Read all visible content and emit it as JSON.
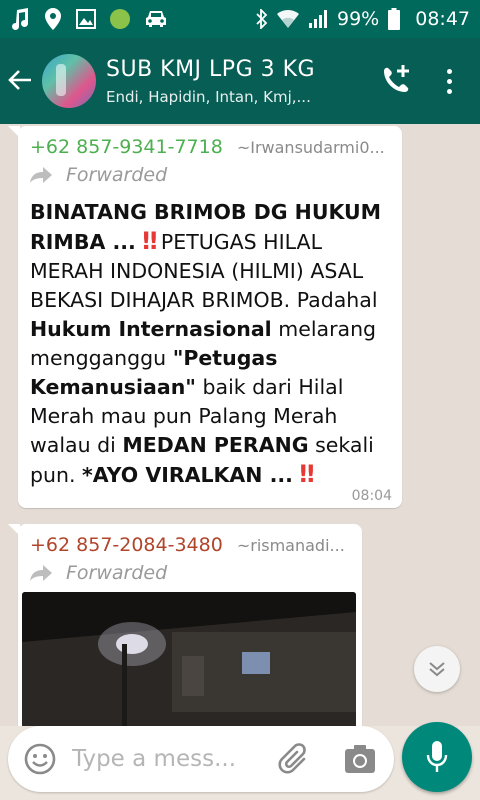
{
  "status_bar": {
    "battery": "99%",
    "time": "08:47"
  },
  "header": {
    "title": "SUB KMJ LPG 3 KG",
    "subtitle": "Endi, Hapidin, Intan, Kmj,..."
  },
  "messages": [
    {
      "sender_phone": "+62 857-9341-7718",
      "sender_alias": "~Irwansudarmi0...",
      "sender_color": "#4caf50",
      "forwarded_label": "Forwarded",
      "text": {
        "p1": "BINATANG BRIMOB DG HUKUM RIMBA ...",
        "p2": "‼",
        "p3": " PETUGAS HILAL MERAH INDONESIA (HILMI) ASAL BEKASI DIHAJAR BRIMOB. Padahal ",
        "p4": "Hukum Internasional",
        "p5": " melarang mengganggu ",
        "p6": "\"Petugas Kemanusiaan\"",
        "p7": " baik dari Hilal Merah mau pun Palang Merah walau di ",
        "p8": "MEDAN PERANG",
        "p9": " sekali pun. ",
        "p10": "*AYO VIRALKAN ...",
        "p11": "‼"
      },
      "time": "08:04"
    },
    {
      "sender_phone": "+62 857-2084-3480",
      "sender_alias": "~rismanadi...",
      "sender_color": "#b0452b",
      "forwarded_label": "Forwarded"
    }
  ],
  "input": {
    "placeholder": "Type a mess..."
  },
  "colors": {
    "status_bar": "#00695c",
    "app_bar": "#075e54",
    "mic_button": "#00897b",
    "chat_background": "#e5ddd5"
  },
  "icons": [
    "music-note-icon",
    "location-pin-icon",
    "image-icon",
    "green-dot-icon",
    "car-icon",
    "bluetooth-icon",
    "wifi-icon",
    "signal-icon",
    "battery-icon",
    "back-arrow-icon",
    "add-call-icon",
    "more-options-icon",
    "forward-arrow-icon",
    "chevron-down-icon",
    "emoji-icon",
    "paperclip-icon",
    "camera-icon",
    "microphone-icon"
  ]
}
